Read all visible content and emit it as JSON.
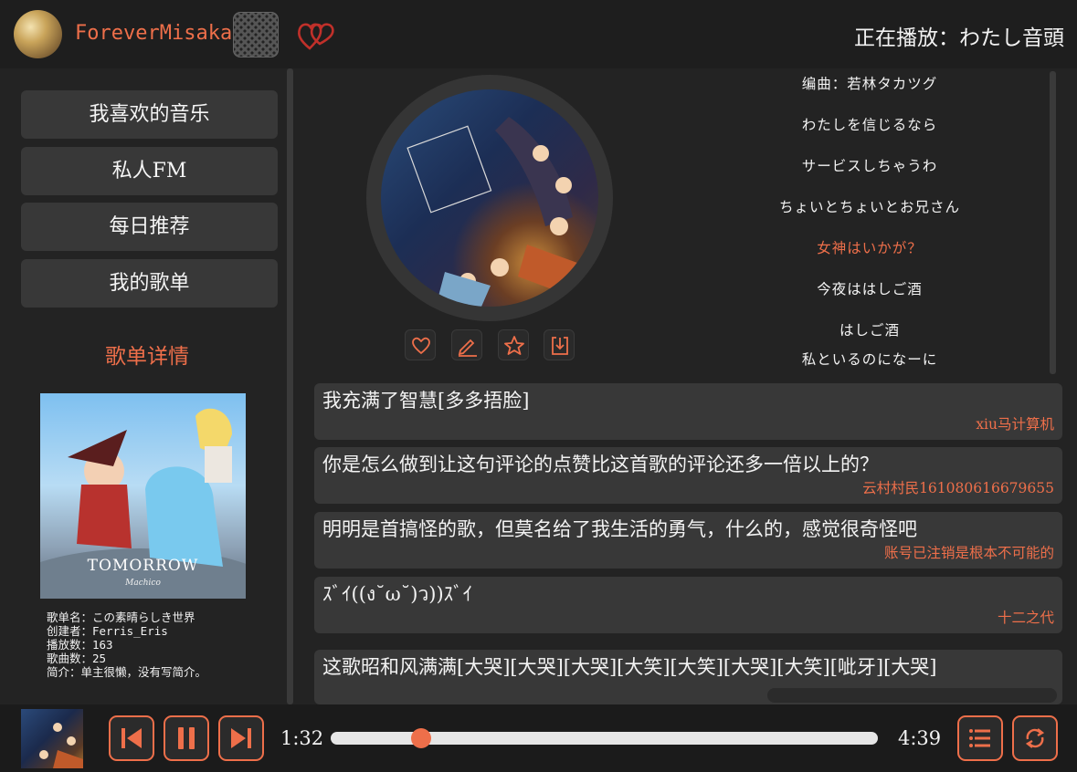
{
  "header": {
    "username": "ForeverMisaka",
    "now_playing": "正在播放：わたし音頭"
  },
  "sidebar": {
    "nav": [
      {
        "label": "我喜欢的音乐"
      },
      {
        "label": "私人FM"
      },
      {
        "label": "每日推荐"
      },
      {
        "label": "我的歌单"
      }
    ],
    "detail_title": "歌单详情",
    "cover": {
      "title": "TOMORROW",
      "subtitle": "Machico"
    },
    "info": [
      "歌单名：この素晴らしき世界",
      "创建者：Ferris_Eris",
      "播放数：163",
      "歌曲数：25",
      "简介：单主很懒，没有写简介。"
    ]
  },
  "lyrics": [
    {
      "text": "编曲：若林タカツグ",
      "active": false
    },
    {
      "text": "わたしを信じるなら",
      "active": false
    },
    {
      "text": "サービスしちゃうわ",
      "active": false
    },
    {
      "text": "ちょいとちょいとお兄さん",
      "active": false
    },
    {
      "text": "女神はいかが？",
      "active": true
    },
    {
      "text": "今夜ははしご酒",
      "active": false
    },
    {
      "text": "はしご酒",
      "active": false
    },
    {
      "text": "私といるのになーに",
      "active": false
    }
  ],
  "comments": [
    {
      "text": "我充满了智慧[多多捂脸]",
      "author": "xiu马计算机"
    },
    {
      "text": "你是怎么做到让这句评论的点赞比这首歌的评论还多一倍以上的？",
      "author": "云村村民161080616679655"
    },
    {
      "text": "明明是首搞怪的歌，但莫名给了我生活的勇气，什么的，感觉很奇怪吧",
      "author": "账号已注销是根本不可能的"
    },
    {
      "text": "ｽﾞｲ((ง˘ω˘)ว))ｽﾞｲ",
      "author": "十二之代"
    },
    {
      "text": "这歌昭和风满满[大哭][大哭][大哭][大笑][大笑][大哭][大笑][呲牙][大哭]",
      "author": ""
    }
  ],
  "player": {
    "current_time": "1:32",
    "total_time": "4:39",
    "progress_fraction": 0.165
  },
  "colors": {
    "accent": "#ee6f4a",
    "background": "#232323",
    "card": "#383838"
  },
  "icons": {
    "song_actions": [
      "heart-outline-icon",
      "edit-icon",
      "star-icon",
      "download-icon"
    ],
    "controls": [
      "skip-previous-icon",
      "pause-icon",
      "skip-next-icon",
      "playlist-icon",
      "loop-icon"
    ]
  }
}
